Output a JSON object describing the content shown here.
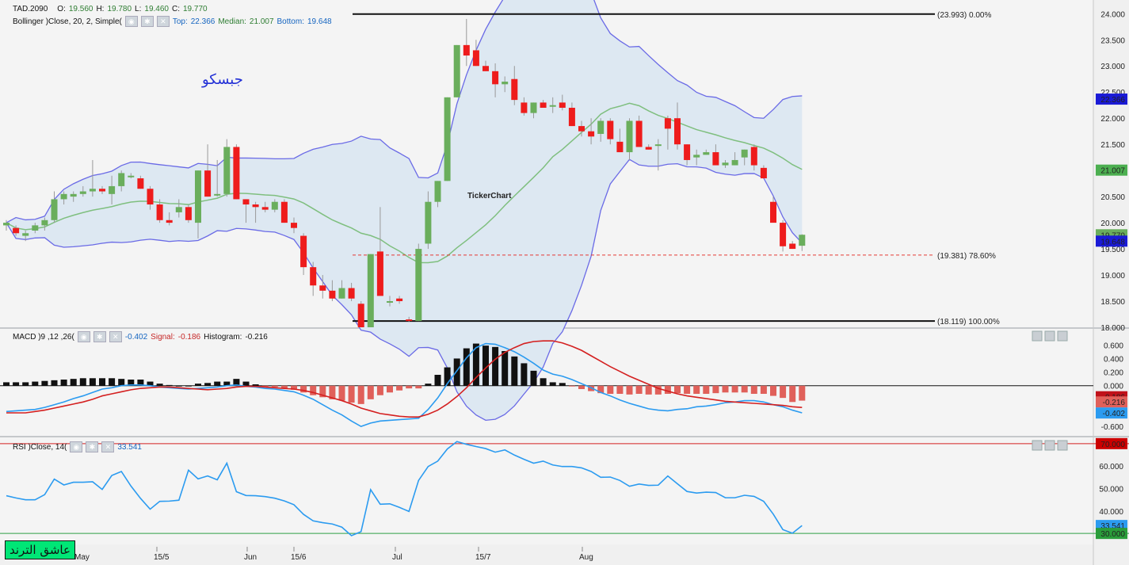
{
  "symbol": "TAD.2090",
  "ohlc": {
    "o_label": "O:",
    "o": "19.560",
    "h_label": "H:",
    "h": "19.780",
    "l_label": "L:",
    "l": "19.460",
    "c_label": "C:",
    "c": "19.770"
  },
  "bollinger": {
    "label": "Bollinger  )Close, 20, 2, Simple(",
    "top_label": "Top:",
    "top": "22.366",
    "median_label": "Median:",
    "median": "21.007",
    "bottom_label": "Bottom:",
    "bottom": "19.648"
  },
  "macd": {
    "label": "MACD  )9 ,12 ,26(",
    "value": "-0.402",
    "signal_label": "Signal:",
    "signal": "-0.186",
    "hist_label": "Histogram:",
    "hist": "-0.216"
  },
  "rsi": {
    "label": "RSI  )Close, 14(",
    "value": "33.541"
  },
  "title_ar": "جبسكو",
  "watermark": "TickerChart",
  "badge": "عاشق الترند",
  "fib": [
    {
      "label": "(23.993) 0.00%",
      "price": 23.993
    },
    {
      "label": "(19.381) 78.60%",
      "price": 19.381
    },
    {
      "label": "(18.119) 100.00%",
      "price": 18.119
    }
  ],
  "colors": {
    "up": "#6aae5c",
    "down": "#ee1c1c",
    "band": "#6a6ae6",
    "median": "#7fbf7f",
    "macd": "#2b9bf0",
    "signal": "#d42020",
    "rsi": "#2b9bf0",
    "fill": "#dde8f2"
  },
  "chart_data": [
    {
      "type": "candlestick",
      "title": "TAD.2090",
      "yaxis_ticks": [
        18.0,
        18.5,
        19.0,
        19.5,
        20.0,
        20.5,
        21.0,
        21.5,
        22.0,
        22.5,
        23.0,
        23.5,
        24.0
      ],
      "ylim": [
        18.0,
        24.05
      ],
      "x_labels": [
        "May",
        "15/5",
        "Jun",
        "15/6",
        "Jul",
        "15/7",
        "Aug"
      ],
      "last_value_tags": [
        {
          "text": "22.366",
          "color": "#1a1ad6"
        },
        {
          "text": "21.007",
          "color": "#4caf50"
        },
        {
          "text": "19.770",
          "color": "#6aae5c"
        },
        {
          "text": "19.648",
          "color": "#1a1ad6"
        }
      ],
      "candles": [
        [
          19.95,
          20.05,
          19.85,
          20.0
        ],
        [
          19.9,
          19.95,
          19.75,
          19.8
        ],
        [
          19.75,
          19.85,
          19.65,
          19.8
        ],
        [
          19.85,
          20.0,
          19.8,
          19.95
        ],
        [
          19.95,
          20.1,
          19.85,
          20.05
        ],
        [
          20.05,
          20.6,
          20.0,
          20.45
        ],
        [
          20.45,
          20.6,
          20.35,
          20.55
        ],
        [
          20.5,
          20.6,
          20.4,
          20.55
        ],
        [
          20.55,
          20.7,
          20.5,
          20.6
        ],
        [
          20.6,
          21.2,
          20.5,
          20.65
        ],
        [
          20.65,
          20.7,
          20.55,
          20.6
        ],
        [
          20.55,
          20.9,
          20.35,
          20.7
        ],
        [
          20.7,
          21.0,
          20.6,
          20.95
        ],
        [
          20.9,
          20.95,
          20.85,
          20.9
        ],
        [
          20.85,
          20.9,
          20.65,
          20.65
        ],
        [
          20.65,
          20.7,
          20.25,
          20.35
        ],
        [
          20.35,
          20.45,
          20.0,
          20.05
        ],
        [
          20.05,
          20.2,
          19.95,
          20.0
        ],
        [
          20.2,
          20.45,
          20.1,
          20.3
        ],
        [
          20.3,
          20.35,
          20.0,
          20.05
        ],
        [
          20.0,
          21.0,
          19.7,
          21.0
        ],
        [
          21.0,
          21.5,
          20.5,
          20.5
        ],
        [
          20.55,
          21.2,
          20.5,
          20.55
        ],
        [
          20.55,
          21.6,
          20.5,
          21.45
        ],
        [
          21.45,
          21.5,
          20.45,
          20.45
        ],
        [
          20.45,
          20.45,
          20.0,
          20.35
        ],
        [
          20.35,
          20.4,
          20.0,
          20.3
        ],
        [
          20.3,
          20.4,
          20.2,
          20.25
        ],
        [
          20.25,
          20.45,
          20.2,
          20.4
        ],
        [
          20.4,
          20.45,
          20.0,
          20.0
        ],
        [
          20.0,
          20.1,
          19.8,
          19.9
        ],
        [
          19.75,
          19.8,
          19.0,
          19.15
        ],
        [
          19.15,
          19.25,
          18.6,
          18.8
        ],
        [
          18.8,
          19.0,
          18.55,
          18.7
        ],
        [
          18.7,
          18.9,
          18.5,
          18.55
        ],
        [
          18.55,
          18.9,
          18.55,
          18.75
        ],
        [
          18.75,
          18.85,
          18.5,
          18.55
        ],
        [
          18.45,
          18.5,
          18.0,
          18.0
        ],
        [
          18.0,
          19.4,
          18.0,
          19.4
        ],
        [
          19.45,
          20.3,
          19.45,
          18.6
        ],
        [
          18.5,
          18.6,
          18.4,
          18.5
        ],
        [
          18.55,
          18.6,
          18.45,
          18.5
        ],
        [
          18.15,
          18.2,
          18.1,
          18.12
        ],
        [
          18.12,
          19.6,
          18.12,
          19.5
        ],
        [
          19.6,
          20.6,
          19.5,
          20.4
        ],
        [
          20.4,
          20.8,
          20.3,
          20.8
        ],
        [
          20.8,
          22.4,
          20.8,
          22.4
        ],
        [
          22.4,
          23.4,
          22.4,
          23.4
        ],
        [
          23.4,
          23.9,
          23.0,
          23.2
        ],
        [
          23.3,
          23.5,
          23.0,
          23.0
        ],
        [
          23.0,
          23.1,
          22.9,
          22.9
        ],
        [
          22.9,
          23.05,
          22.4,
          22.65
        ],
        [
          22.65,
          22.8,
          22.5,
          22.7
        ],
        [
          22.75,
          23.0,
          22.25,
          22.35
        ],
        [
          22.3,
          22.4,
          22.05,
          22.1
        ],
        [
          22.1,
          22.3,
          22.0,
          22.3
        ],
        [
          22.3,
          22.35,
          22.2,
          22.2
        ],
        [
          22.25,
          22.4,
          22.1,
          22.25
        ],
        [
          22.3,
          22.45,
          22.15,
          22.2
        ],
        [
          22.2,
          22.3,
          21.85,
          21.85
        ],
        [
          21.85,
          21.95,
          21.65,
          21.75
        ],
        [
          21.75,
          22.0,
          21.5,
          21.65
        ],
        [
          21.7,
          22.0,
          21.55,
          21.95
        ],
        [
          21.95,
          22.0,
          21.5,
          21.6
        ],
        [
          21.55,
          21.8,
          21.35,
          21.35
        ],
        [
          21.35,
          22.0,
          21.2,
          21.95
        ],
        [
          21.95,
          22.05,
          21.45,
          21.45
        ],
        [
          21.45,
          21.5,
          21.4,
          21.4
        ],
        [
          21.5,
          21.6,
          21.0,
          21.5
        ],
        [
          22.0,
          22.05,
          21.4,
          21.8
        ],
        [
          22.0,
          22.3,
          21.4,
          21.5
        ],
        [
          21.5,
          21.5,
          21.1,
          21.2
        ],
        [
          21.25,
          21.4,
          21.1,
          21.3
        ],
        [
          21.3,
          21.4,
          21.3,
          21.35
        ],
        [
          21.35,
          21.5,
          21.1,
          21.1
        ],
        [
          21.1,
          21.2,
          21.05,
          21.15
        ],
        [
          21.1,
          21.35,
          21.1,
          21.2
        ],
        [
          21.25,
          21.4,
          21.1,
          21.4
        ],
        [
          21.45,
          21.5,
          21.0,
          21.1
        ],
        [
          21.05,
          21.1,
          20.85,
          20.85
        ],
        [
          20.4,
          20.5,
          20.2,
          20.0
        ],
        [
          20.0,
          20.05,
          19.45,
          19.55
        ],
        [
          19.6,
          19.65,
          19.5,
          19.5
        ],
        [
          19.56,
          19.78,
          19.46,
          19.77
        ]
      ]
    },
    {
      "type": "macd",
      "title": "MACD",
      "yaxis_ticks": [
        0.6,
        0.4,
        0.2,
        0.0,
        -0.2,
        -0.4,
        -0.6
      ],
      "ylim": [
        -0.68,
        0.72
      ],
      "last_value_tags": [
        {
          "text": "-0.186",
          "color": "#c0111a"
        },
        {
          "text": "-0.216",
          "color": "#e0605a"
        },
        {
          "text": "-0.402",
          "color": "#2b9bf0"
        }
      ],
      "histogram": [
        0.05,
        0.05,
        0.05,
        0.06,
        0.07,
        0.08,
        0.09,
        0.1,
        0.11,
        0.11,
        0.11,
        0.11,
        0.1,
        0.09,
        0.09,
        0.06,
        0.03,
        0.01,
        0.0,
        0.0,
        0.03,
        0.04,
        0.06,
        0.06,
        0.1,
        0.06,
        0.02,
        -0.02,
        -0.02,
        -0.04,
        -0.06,
        -0.1,
        -0.14,
        -0.17,
        -0.2,
        -0.22,
        -0.25,
        -0.27,
        -0.2,
        -0.14,
        -0.1,
        -0.07,
        -0.04,
        -0.04,
        0.03,
        0.16,
        0.27,
        0.4,
        0.55,
        0.62,
        0.59,
        0.57,
        0.51,
        0.43,
        0.33,
        0.22,
        0.11,
        0.05,
        0.04,
        -0.01,
        -0.05,
        -0.08,
        -0.11,
        -0.12,
        -0.12,
        -0.13,
        -0.12,
        -0.13,
        -0.13,
        -0.12,
        -0.11,
        -0.12,
        -0.12,
        -0.12,
        -0.11,
        -0.1,
        -0.1,
        -0.1,
        -0.12,
        -0.12,
        -0.15,
        -0.18,
        -0.24,
        -0.22
      ],
      "macd": [
        -0.38,
        -0.37,
        -0.36,
        -0.35,
        -0.32,
        -0.28,
        -0.24,
        -0.19,
        -0.15,
        -0.1,
        -0.05,
        -0.03,
        0.0,
        0.01,
        0.01,
        0.0,
        -0.02,
        -0.03,
        -0.04,
        -0.05,
        -0.04,
        -0.03,
        -0.02,
        0.0,
        0.01,
        -0.01,
        -0.02,
        -0.04,
        -0.05,
        -0.07,
        -0.09,
        -0.14,
        -0.2,
        -0.28,
        -0.36,
        -0.43,
        -0.52,
        -0.6,
        -0.55,
        -0.52,
        -0.51,
        -0.5,
        -0.49,
        -0.48,
        -0.35,
        -0.18,
        0.03,
        0.22,
        0.41,
        0.56,
        0.62,
        0.61,
        0.56,
        0.5,
        0.42,
        0.33,
        0.23,
        0.17,
        0.14,
        0.09,
        0.03,
        -0.03,
        -0.1,
        -0.15,
        -0.21,
        -0.26,
        -0.3,
        -0.34,
        -0.36,
        -0.37,
        -0.35,
        -0.34,
        -0.31,
        -0.3,
        -0.28,
        -0.25,
        -0.24,
        -0.22,
        -0.22,
        -0.24,
        -0.28,
        -0.31,
        -0.36,
        -0.4
      ],
      "signal": [
        -0.4,
        -0.4,
        -0.4,
        -0.38,
        -0.36,
        -0.33,
        -0.3,
        -0.27,
        -0.24,
        -0.2,
        -0.15,
        -0.12,
        -0.09,
        -0.06,
        -0.04,
        -0.03,
        -0.02,
        -0.02,
        -0.03,
        -0.04,
        -0.05,
        -0.06,
        -0.05,
        -0.04,
        -0.02,
        -0.01,
        -0.01,
        -0.02,
        -0.03,
        -0.04,
        -0.05,
        -0.07,
        -0.1,
        -0.14,
        -0.18,
        -0.22,
        -0.27,
        -0.33,
        -0.37,
        -0.41,
        -0.43,
        -0.45,
        -0.46,
        -0.46,
        -0.42,
        -0.36,
        -0.27,
        -0.16,
        -0.03,
        0.12,
        0.26,
        0.39,
        0.49,
        0.56,
        0.62,
        0.65,
        0.66,
        0.66,
        0.63,
        0.58,
        0.52,
        0.44,
        0.36,
        0.28,
        0.21,
        0.14,
        0.08,
        0.02,
        -0.04,
        -0.08,
        -0.12,
        -0.15,
        -0.17,
        -0.19,
        -0.21,
        -0.23,
        -0.24,
        -0.25,
        -0.26,
        -0.27,
        -0.28,
        -0.29,
        -0.31,
        -0.32
      ]
    },
    {
      "type": "line",
      "title": "RSI",
      "yaxis_ticks": [
        70,
        60,
        50,
        40,
        30
      ],
      "ylim": [
        29,
        71
      ],
      "last_value_tags": [
        {
          "text": "70.000",
          "color": "#c00"
        },
        {
          "text": "33.541",
          "color": "#2b9bf0"
        },
        {
          "text": "30.000",
          "color": "#2a9d3a"
        }
      ],
      "levels": [
        70,
        30
      ],
      "values": [
        46.8,
        45.8,
        45.0,
        45.0,
        47.3,
        54.2,
        51.6,
        52.8,
        52.8,
        53.0,
        49.6,
        55.8,
        57.6,
        51.1,
        45.6,
        40.8,
        44.3,
        44.4,
        44.8,
        58.2,
        54.3,
        55.6,
        53.9,
        61.3,
        48.6,
        46.9,
        46.8,
        46.4,
        45.7,
        44.5,
        42.8,
        38.5,
        35.6,
        34.8,
        34.2,
        32.8,
        29.0,
        30.8,
        49.5,
        43.0,
        43.2,
        41.6,
        39.8,
        53.6,
        59.8,
        62.2,
        67.6,
        70.9,
        69.7,
        68.7,
        67.8,
        66.2,
        67.2,
        64.9,
        63.0,
        61.3,
        62.2,
        60.5,
        59.8,
        59.8,
        59.2,
        57.6,
        55.0,
        55.1,
        53.6,
        51.0,
        52.0,
        51.4,
        51.5,
        55.6,
        52.1,
        48.7,
        48.0,
        48.4,
        48.2,
        45.9,
        45.9,
        47.0,
        46.5,
        44.3,
        38.6,
        31.7,
        30.1,
        33.5
      ]
    }
  ]
}
